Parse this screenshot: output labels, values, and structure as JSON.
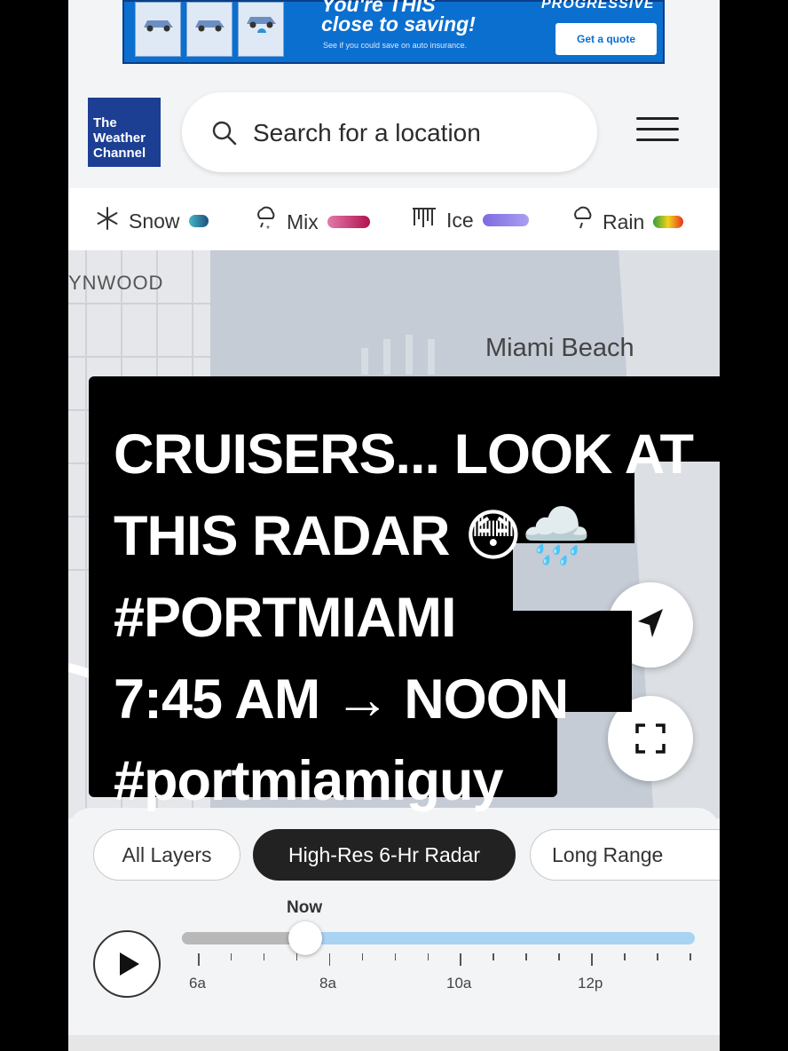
{
  "ad": {
    "headline_line1": "You're THIS",
    "headline_line2": "close to saving!",
    "subtext": "See if you could save on auto insurance.",
    "brand": "PROGRESSIVE",
    "cta": "Get a quote"
  },
  "header": {
    "logo": [
      "The",
      "Weather",
      "Channel"
    ],
    "search_placeholder": "Search for a location"
  },
  "legend": [
    {
      "label": "Snow",
      "icon": "snowflake-icon",
      "colors": [
        "#3fa7b8",
        "#1e4f7a"
      ]
    },
    {
      "label": "Mix",
      "icon": "mix-icon",
      "colors": [
        "#e06aa0",
        "#b0124f"
      ]
    },
    {
      "label": "Ice",
      "icon": "ice-icon",
      "colors": [
        "#8b78e6",
        "#a99cf0"
      ]
    },
    {
      "label": "Rain",
      "icon": "rain-icon",
      "colors": [
        "#2e9e3e",
        "#f2d31c",
        "#e8321e"
      ]
    }
  ],
  "map": {
    "labels": {
      "wynwood": "YNWOOD",
      "miami_beach": "Miami Beach"
    }
  },
  "overlay": {
    "caption": "CRUISERS... LOOK AT\nTHIS RADAR 😳🌧️\n#PORTMIAMI\n7:45 AM → NOON\n#portmiamiguy"
  },
  "layers": {
    "chips": [
      "All Layers",
      "High-Res 6-Hr Radar",
      "Long Range"
    ],
    "active": "High-Res 6-Hr Radar"
  },
  "timeline": {
    "now_label": "Now",
    "tick_labels": [
      "6a",
      "8a",
      "10a",
      "12p"
    ],
    "progress": 0.24
  }
}
